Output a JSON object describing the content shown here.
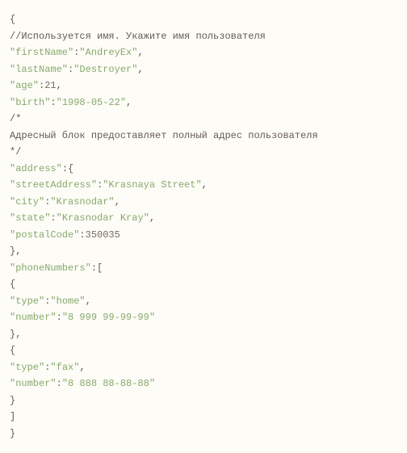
{
  "lines": [
    {
      "type": "brace",
      "text": "{"
    },
    {
      "type": "comment",
      "text": "//Используется имя. Укажите имя пользователя"
    },
    {
      "type": "kv_str",
      "key": "firstName",
      "value": "AndreyEx",
      "trailing": ","
    },
    {
      "type": "kv_str",
      "key": "lastName",
      "value": "Destroyer",
      "trailing": ","
    },
    {
      "type": "kv_num",
      "key": "age",
      "value": "21",
      "trailing": ","
    },
    {
      "type": "kv_str",
      "key": "birth",
      "value": "1998-05-22",
      "trailing": ","
    },
    {
      "type": "comment",
      "text": "/*"
    },
    {
      "type": "comment",
      "text": "Адресный блок предоставляет полный адрес пользователя"
    },
    {
      "type": "comment",
      "text": "*/"
    },
    {
      "type": "key_open",
      "key": "address",
      "open": "{"
    },
    {
      "type": "kv_str",
      "key": "streetAddress",
      "value": "Krasnaya Street",
      "trailing": ","
    },
    {
      "type": "kv_str",
      "key": "city",
      "value": "Krasnodar",
      "trailing": ","
    },
    {
      "type": "kv_str",
      "key": "state",
      "value": "Krasnodar Kray",
      "trailing": ","
    },
    {
      "type": "kv_num",
      "key": "postalCode",
      "value": "350035",
      "trailing": ""
    },
    {
      "type": "brace",
      "text": "},"
    },
    {
      "type": "key_open",
      "key": "phoneNumbers",
      "open": "["
    },
    {
      "type": "brace",
      "text": "{"
    },
    {
      "type": "kv_str",
      "key": "type",
      "value": "home",
      "trailing": ","
    },
    {
      "type": "kv_str",
      "key": "number",
      "value": "8 999 99-99-99",
      "trailing": ""
    },
    {
      "type": "brace",
      "text": "},"
    },
    {
      "type": "brace",
      "text": "{"
    },
    {
      "type": "kv_str",
      "key": "type",
      "value": "fax",
      "trailing": ","
    },
    {
      "type": "kv_str",
      "key": "number",
      "value": "8 888 88-88-88",
      "trailing": ""
    },
    {
      "type": "brace",
      "text": "}"
    },
    {
      "type": "brace",
      "text": "]"
    },
    {
      "type": "brace",
      "text": "}"
    }
  ]
}
